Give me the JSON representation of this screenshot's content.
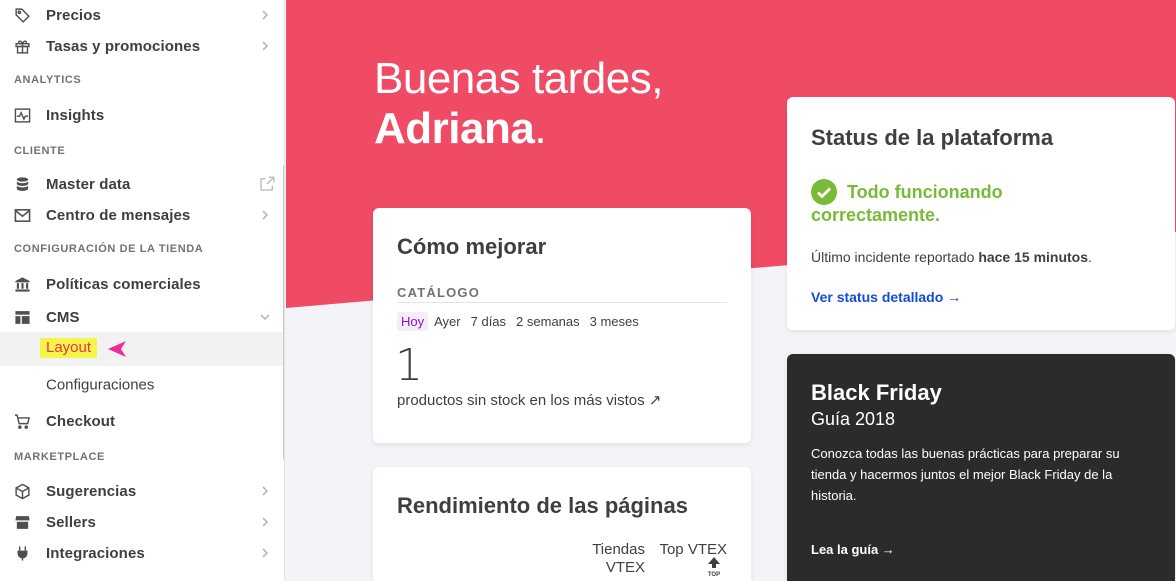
{
  "sidebar": {
    "items": {
      "precios": {
        "label": "Precios",
        "icon": "tag-icon"
      },
      "tasas": {
        "label": "Tasas y promociones",
        "icon": "gift-icon"
      },
      "insights": {
        "label": "Insights",
        "icon": "activity-icon"
      },
      "masterdata": {
        "label": "Master data",
        "icon": "database-icon"
      },
      "mensajes": {
        "label": "Centro de mensajes",
        "icon": "mail-icon"
      },
      "politicas": {
        "label": "Políticas comerciales",
        "icon": "bank-icon"
      },
      "cms": {
        "label": "CMS",
        "icon": "layout-icon"
      },
      "checkout": {
        "label": "Checkout",
        "icon": "cart-icon"
      },
      "sugerencias": {
        "label": "Sugerencias",
        "icon": "cube-icon"
      },
      "sellers": {
        "label": "Sellers",
        "icon": "store-icon"
      },
      "integraciones": {
        "label": "Integraciones",
        "icon": "plug-icon"
      }
    },
    "sections": {
      "analytics": "ANALYTICS",
      "cliente": "CLIENTE",
      "config": "CONFIGURACIÓN DE LA TIENDA",
      "marketplace": "MARKETPLACE"
    },
    "cms_sub": {
      "layout": "Layout",
      "configuraciones": "Configuraciones"
    }
  },
  "hero": {
    "greeting": "Buenas tardes,",
    "name": "Adriana",
    "period": "."
  },
  "mejorar": {
    "title": "Cómo mejorar",
    "section": "CATÁLOGO",
    "periods": [
      "Hoy",
      "Ayer",
      "7 días",
      "2 semanas",
      "3 meses"
    ],
    "selected_period": "Hoy",
    "value": "1",
    "link": "productos sin stock en los más vistos ↗"
  },
  "rendimiento": {
    "title": "Rendimiento de las páginas",
    "col1_line1": "Tiendas",
    "col1_line2": "VTEX",
    "col2": "Top VTEX",
    "top_badge": "TOP"
  },
  "status": {
    "title": "Status de la plataforma",
    "ok": "Todo funcionando correctamente.",
    "incident_prefix": "Último incidente reportado ",
    "incident_time": "hace 15 minutos",
    "incident_suffix": ".",
    "link": "Ver status detallado →"
  },
  "blackfriday": {
    "title": "Black Friday",
    "subtitle": "Guía 2018",
    "description": "Conozca todas las buenas prácticas para preparar su tienda y hacermos juntos el mejor Black Friday de la historia.",
    "link": "Lea la guía →"
  },
  "colors": {
    "brand": "#ef4b65",
    "ok": "#79ba39",
    "link": "#134cd8",
    "dark_card": "#2b2b2c",
    "highlight": "#f5f44a",
    "pointer": "#ef2d96"
  }
}
